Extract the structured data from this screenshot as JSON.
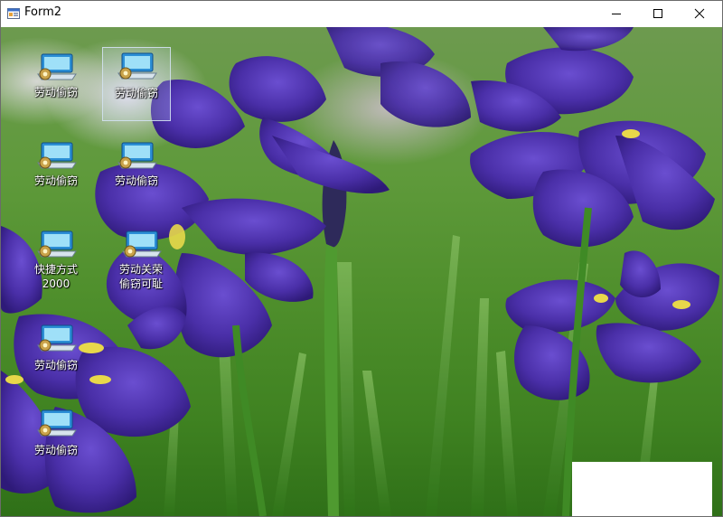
{
  "window": {
    "title": "Form2",
    "controls": {
      "minimize": "minimize-icon",
      "maximize": "maximize-icon",
      "close": "close-icon"
    }
  },
  "desktop": {
    "icons": [
      {
        "label": "劳动偷窃",
        "selected": false
      },
      {
        "label": "劳动偷窃",
        "selected": true
      },
      {
        "label": "劳动偷窃",
        "selected": false
      },
      {
        "label": "劳动偷窃",
        "selected": false
      },
      {
        "label": "快捷方式 2000",
        "selected": false
      },
      {
        "label": "劳动关荣 偷窃可耻",
        "selected": false
      },
      {
        "label": "劳动偷窃",
        "selected": false
      },
      {
        "label": "劳动偷窃",
        "selected": false
      }
    ]
  },
  "colors": {
    "petal": "#4a2fa8",
    "petal_dark": "#2e1a78",
    "leaf": "#3f8a25",
    "selection": "#cde1f5"
  }
}
